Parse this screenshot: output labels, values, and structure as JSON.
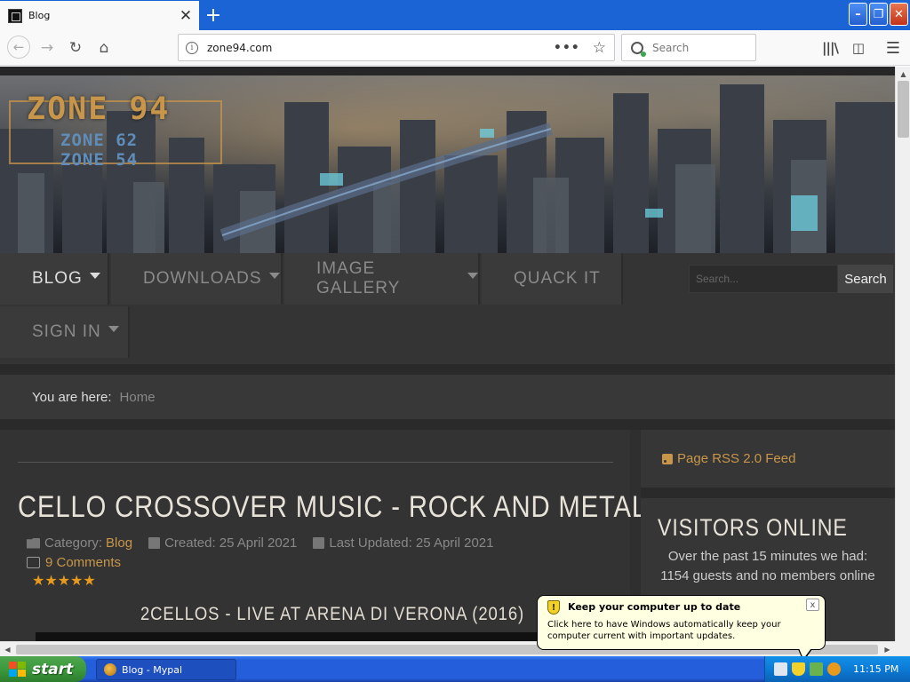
{
  "browser": {
    "tab_title": "Blog",
    "tab_close": "✕",
    "new_tab": "+",
    "url": "zone94.com",
    "url_menu": "•••",
    "search_placeholder": "Search",
    "window_min": "–",
    "window_max": "❐",
    "window_close": "✕"
  },
  "site": {
    "logo_main": "ZONE 94",
    "logo_sub1": "ZONE 62",
    "logo_sub2": "ZONE 54",
    "menu": {
      "blog": "BLOG",
      "downloads": "DOWNLOADS",
      "gallery": "IMAGE GALLERY",
      "quack": "QUACK IT",
      "signin": "SIGN IN"
    },
    "search_placeholder": "Search...",
    "search_button": "Search",
    "breadcrumb_label": "You are here:",
    "breadcrumb_home": "Home"
  },
  "article": {
    "title": "CELLO CROSSOVER MUSIC - ROCK AND METAL",
    "category_label": "Category:",
    "category": "Blog",
    "created": "Created: 25 April 2021",
    "updated": "Last Updated: 25 April 2021",
    "comments": "9 Comments",
    "rating_stars": "★★★★★",
    "rating": 5,
    "video_title": "2CELLOS - LIVE AT ARENA DI VERONA (2016)"
  },
  "sidebar": {
    "rss": "Page RSS 2.0 Feed",
    "visitors_title": "VISITORS ONLINE",
    "visitors_text": "Over the past 15 minutes we had: 1154 guests and no members online"
  },
  "balloon": {
    "title": "Keep your computer up to date",
    "text": "Click here to have Windows automatically keep your computer current with important updates.",
    "close": "x"
  },
  "taskbar": {
    "start": "start",
    "task_item": "Blog - Mypal",
    "time": "11:15 PM"
  },
  "colors": {
    "accent": "#c8964a",
    "titlebar": "#1a64d6",
    "taskbar": "#245edb"
  }
}
